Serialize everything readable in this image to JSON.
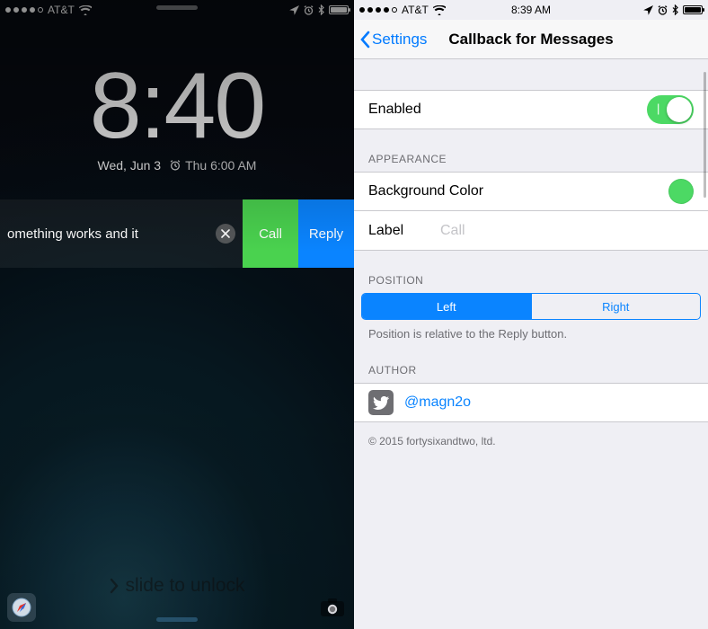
{
  "left": {
    "status": {
      "carrier": "AT&T",
      "signal_active": 4,
      "signal_total": 5
    },
    "time": "8:40",
    "date": "Wed, Jun 3",
    "alarm": "Thu 6:00 AM",
    "notification": {
      "text": "omething works and it",
      "dismiss": "dismiss",
      "call": "Call",
      "reply": "Reply"
    },
    "unlock": "slide to unlock"
  },
  "right": {
    "status": {
      "carrier": "AT&T",
      "signal_active": 4,
      "signal_total": 5,
      "time": "8:39 AM"
    },
    "nav": {
      "back": "Settings",
      "title": "Callback for Messages"
    },
    "enabled": {
      "label": "Enabled",
      "value": true
    },
    "appearance": {
      "header": "APPEARANCE",
      "bgcolor_label": "Background Color",
      "bgcolor_value": "#4cd964",
      "label_label": "Label",
      "label_value": "Call"
    },
    "position": {
      "header": "POSITION",
      "options": [
        "Left",
        "Right"
      ],
      "selected": "Left",
      "hint": "Position is relative to the Reply button."
    },
    "author": {
      "header": "AUTHOR",
      "handle": "@magn2o",
      "copyright": "© 2015 fortysixandtwo, ltd."
    }
  }
}
